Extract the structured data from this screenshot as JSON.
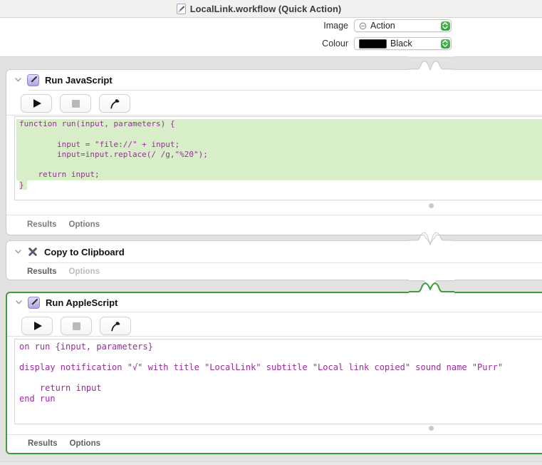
{
  "window": {
    "title": "LocalLink.workflow (Quick Action)",
    "icon": "workflow-document-icon"
  },
  "form": {
    "image": {
      "label": "Image",
      "value": "Action",
      "icon": "action-template-icon"
    },
    "colour": {
      "label": "Colour",
      "value": "Black",
      "swatch_color": "#000000"
    }
  },
  "actions": [
    {
      "title": "Run JavaScript",
      "icon": "run-script-icon",
      "toolbar_icons": [
        "play-icon",
        "stop-icon",
        "hammer-icon"
      ],
      "footer": {
        "results": "Results",
        "options": "Options"
      },
      "code_lines": [
        {
          "text": "function run(input, parameters) {",
          "hl": "full"
        },
        {
          "text": "",
          "hl": "full"
        },
        {
          "text": "        input = \"file://\" + input;",
          "hl": "full"
        },
        {
          "text": "        input=input.replace(/ /g,\"%20\");",
          "hl": "full"
        },
        {
          "text": "",
          "hl": "full"
        },
        {
          "text": "    return input;",
          "hl": "full"
        },
        {
          "text": "}",
          "hl": "partial"
        }
      ]
    },
    {
      "title": "Copy to Clipboard",
      "icon": "utilities-x-icon",
      "footer": {
        "results": "Results",
        "options": "Options"
      }
    },
    {
      "title": "Run AppleScript",
      "icon": "run-script-icon",
      "selected": true,
      "toolbar_icons": [
        "play-icon",
        "stop-icon",
        "hammer-icon"
      ],
      "footer": {
        "results": "Results",
        "options": "Options"
      },
      "code_lines": [
        {
          "text": "on run {input, parameters}"
        },
        {
          "text": ""
        },
        {
          "text": "display notification \"√\" with title \"LocalLink\" subtitle \"Local link copied\" sound name \"Purr\""
        },
        {
          "text": ""
        },
        {
          "text": "    return input"
        },
        {
          "text": "end run"
        }
      ]
    }
  ],
  "colors": {
    "accent_green_stepper": "#3fae49",
    "selection_border_green": "#3e9b40",
    "code_selection_green": "#d8eec8",
    "javascript_text": "#8f3590",
    "applescript_text": "#992b9b",
    "workspace_gray": "#e2e2e1"
  }
}
